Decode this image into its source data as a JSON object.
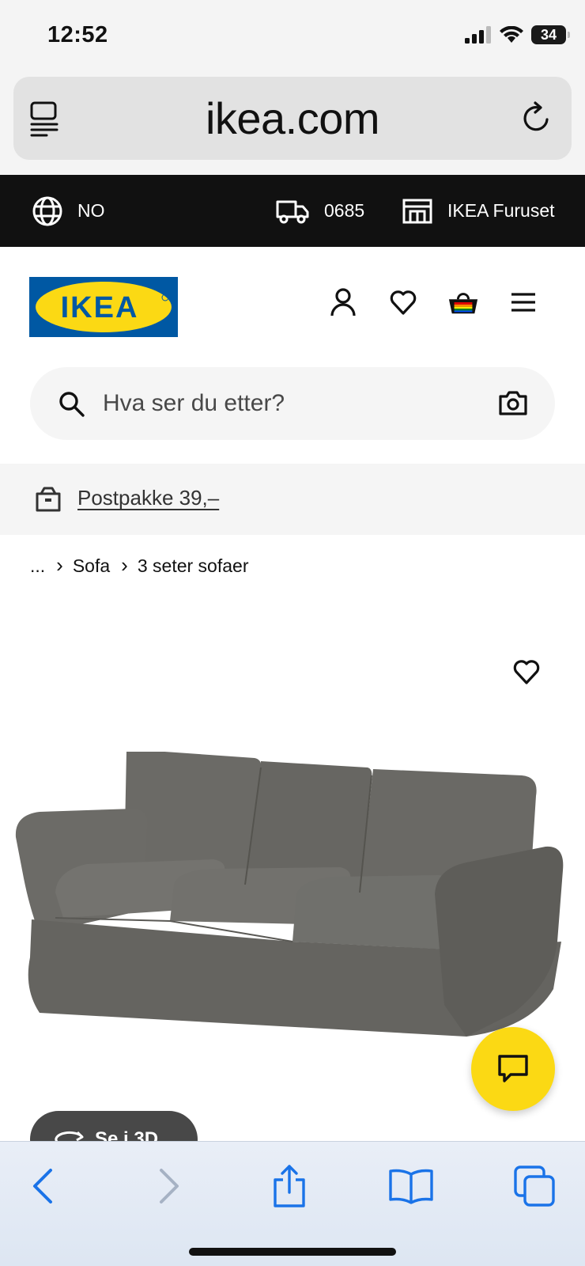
{
  "status_bar": {
    "time": "12:52",
    "battery": "34"
  },
  "browser": {
    "url": "ikea.com"
  },
  "top_strip": {
    "region": "NO",
    "postcode": "0685",
    "store": "IKEA Furuset"
  },
  "header": {
    "logo_text": "IKEA"
  },
  "search": {
    "placeholder": "Hva ser du etter?"
  },
  "promo": {
    "text": "Postpakke 39,–"
  },
  "breadcrumb": {
    "ellipsis": "...",
    "items": [
      "Sofa",
      "3 seter sofaer"
    ]
  },
  "product": {
    "view3d_label": "Se i 3D"
  },
  "colors": {
    "ikea_blue": "#0058a3",
    "ikea_yellow": "#fbd914",
    "toolbar_blue": "#1a73e8"
  }
}
